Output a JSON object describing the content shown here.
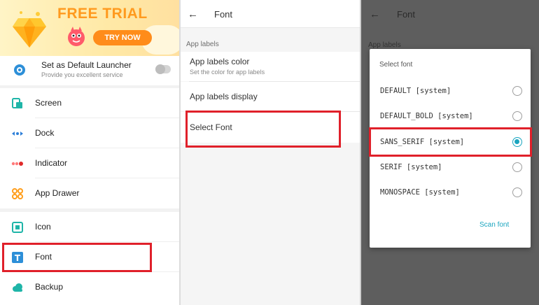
{
  "panel_launcher": {
    "banner": {
      "title": "FREE TRIAL",
      "button": "TRY NOW"
    },
    "default_launcher": {
      "title": "Set as Default Launcher",
      "subtitle": "Provide you excellent service"
    },
    "menu": [
      {
        "label": "Screen",
        "icon": "screen-icon"
      },
      {
        "label": "Dock",
        "icon": "dock-icon"
      },
      {
        "label": "Indicator",
        "icon": "indicator-icon"
      },
      {
        "label": "App Drawer",
        "icon": "app-drawer-icon"
      },
      {
        "label": "Icon",
        "icon": "icon-icon"
      },
      {
        "label": "Font",
        "icon": "font-icon"
      },
      {
        "label": "Backup",
        "icon": "backup-icon"
      }
    ]
  },
  "panel_font": {
    "title": "Font",
    "section": "App labels",
    "items": [
      {
        "label": "App labels color",
        "subtitle": "Set the color for app labels"
      },
      {
        "label": "App labels display"
      },
      {
        "label": "Select Font"
      }
    ]
  },
  "panel_dialog": {
    "title": "Font",
    "behind_label": "App labels",
    "dialog_title": "Select font",
    "options": [
      {
        "label": "DEFAULT [system]",
        "selected": false
      },
      {
        "label": "DEFAULT_BOLD [system]",
        "selected": false
      },
      {
        "label": "SANS_SERIF [system]",
        "selected": true
      },
      {
        "label": "SERIF [system]",
        "selected": false
      },
      {
        "label": "MONOSPACE [system]",
        "selected": false
      }
    ],
    "scan": "Scan font"
  },
  "colors": {
    "highlight": "#e0202a",
    "accent": "#1aa5bf",
    "banner_orange": "#ff9a1e"
  }
}
